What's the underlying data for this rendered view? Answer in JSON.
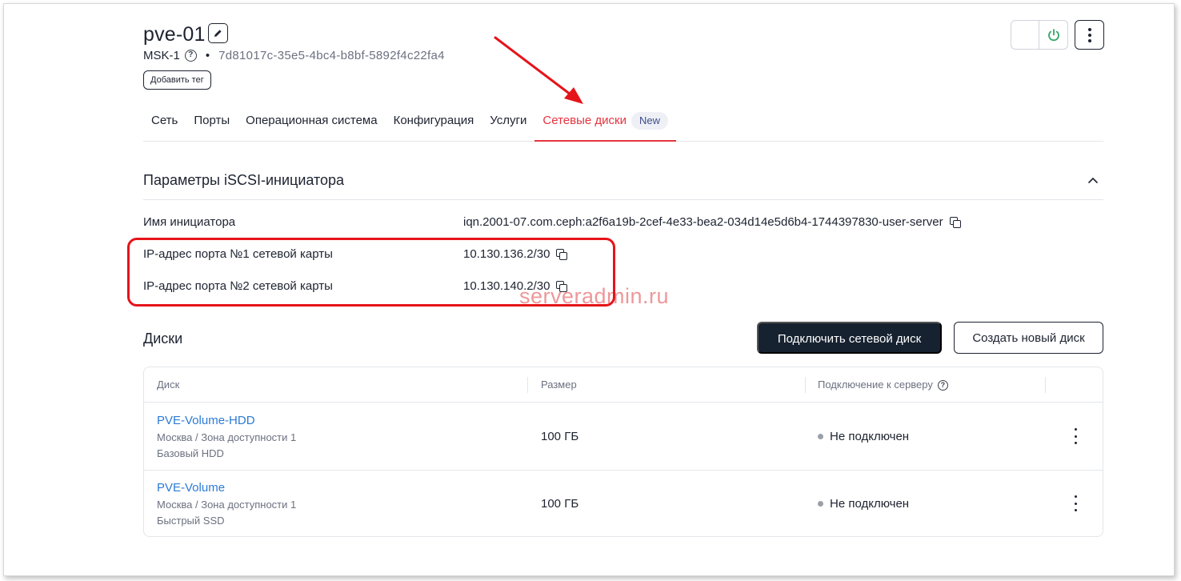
{
  "server": {
    "name": "pve-01",
    "location": "MSK-1",
    "bullet": "•",
    "uuid": "7d81017c-35e5-4bc4-b8bf-5892f4c22fa4",
    "add_tag_label": "Добавить тег"
  },
  "tabs": [
    {
      "label": "Сеть"
    },
    {
      "label": "Порты"
    },
    {
      "label": "Операционная система"
    },
    {
      "label": "Конфигурация"
    },
    {
      "label": "Услуги"
    },
    {
      "label": "Сетевые диски",
      "badge": "New",
      "active": true
    }
  ],
  "iscsi": {
    "title": "Параметры iSCSI-инициатора",
    "rows": [
      {
        "label": "Имя инициатора",
        "value": "iqn.2001-07.com.ceph:a2f6a19b-2cef-4e33-bea2-034d14e5d6b4-1744397830-user-server"
      },
      {
        "label": "IP-адрес порта №1 сетевой карты",
        "value": "10.130.136.2/30"
      },
      {
        "label": "IP-адрес порта №2 сетевой карты",
        "value": "10.130.140.2/30"
      }
    ]
  },
  "watermark": "serveradmin.ru",
  "disks": {
    "title": "Диски",
    "connect_button": "Подключить сетевой диск",
    "create_button": "Создать новый диск",
    "columns": [
      "Диск",
      "Размер",
      "Подключение к серверу"
    ],
    "rows": [
      {
        "name": "PVE-Volume-HDD",
        "location": "Москва / Зона доступности 1",
        "type": "Базовый HDD",
        "size": "100 ГБ",
        "status": "Не подключен"
      },
      {
        "name": "PVE-Volume",
        "location": "Москва / Зона доступности 1",
        "type": "Быстрый SSD",
        "size": "100 ГБ",
        "status": "Не подключен"
      }
    ]
  },
  "colors": {
    "accent_red": "#e5343f",
    "link_blue": "#2b7bd6",
    "power_green": "#2fa866",
    "primary_dark": "#172230"
  },
  "icons": [
    "pencil-icon",
    "help-icon",
    "power-icon",
    "more-vertical-icon",
    "chevron-up-icon",
    "copy-icon"
  ]
}
